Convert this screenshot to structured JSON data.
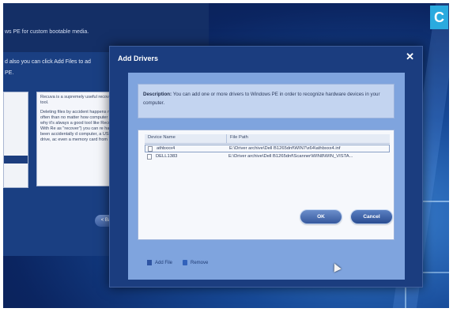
{
  "background_window": {
    "header_text": "ws PE for custom bootable media.",
    "line1": "d also you can click Add Files to ad",
    "line2": "PE.",
    "description_paragraphs": [
      "Recuva is a supremely useful recovery tool.",
      "Deleting files by accident happens more often than no matter how computer li is why it's always a good tool like Recuva. With Re as \"recover\") you can re have been accidentally d computer, a USB drive, ac even a memory card from"
    ],
    "back_button": "< Back"
  },
  "dialog": {
    "title": "Add Drivers",
    "close_glyph": "✕",
    "description_label": "Description:",
    "description_text": "You can add one or more drivers to Windows PE in order to recognize hardware devices in your computer.",
    "columns": [
      "Device Name",
      "File Path"
    ],
    "rows": [
      {
        "device": "athbxxx4",
        "path": "E:\\Driver archive\\Dell B1265dnf\\WIN7\\x64\\athbxxx4.inf"
      },
      {
        "device": "DELL1383",
        "path": "E:\\Driver archive\\Dell B1265dnf\\Scanner\\WIN8\\WIN_VISTA..."
      }
    ],
    "add_file_label": "Add File",
    "remove_label": "Remove",
    "ok_label": "OK",
    "cancel_label": "Cancel"
  },
  "badge": "C"
}
